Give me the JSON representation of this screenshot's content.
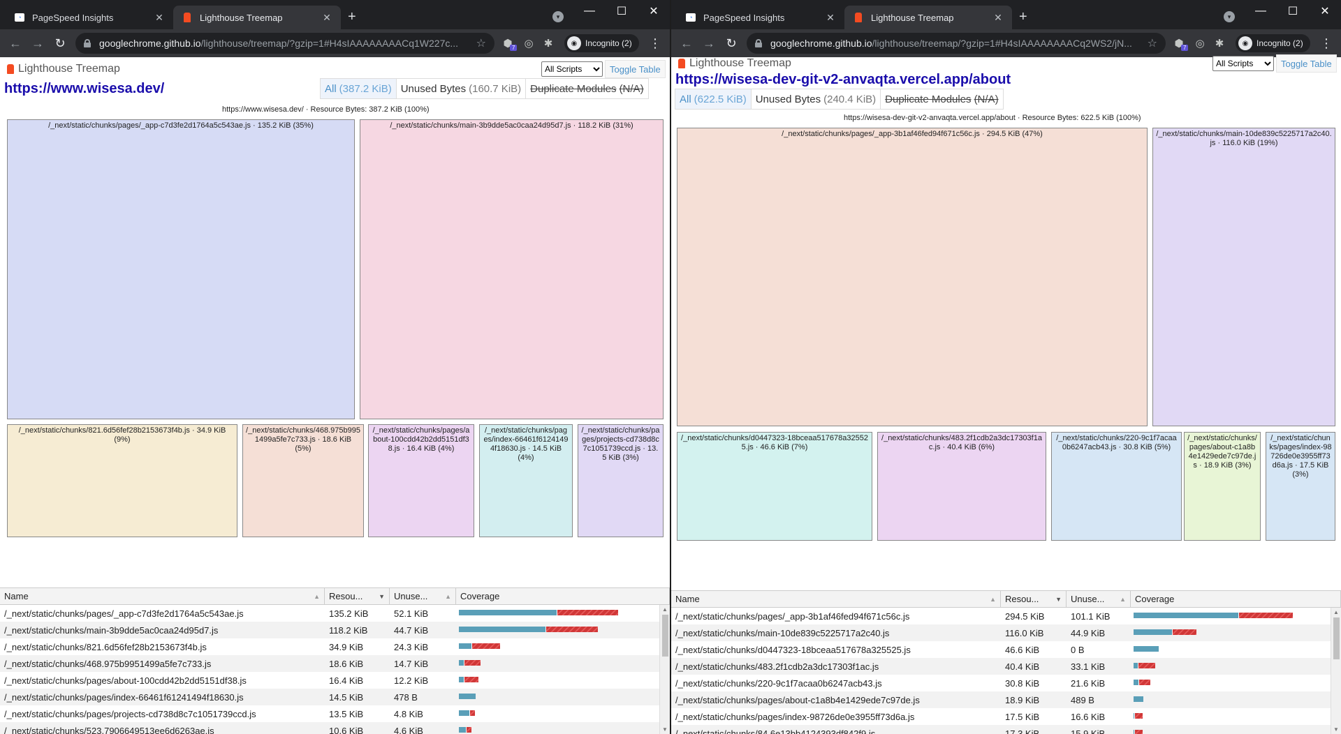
{
  "left": {
    "tabs": [
      {
        "title": "PageSpeed Insights"
      },
      {
        "title": "Lighthouse Treemap"
      }
    ],
    "address": {
      "host": "googlechrome.github.io",
      "path": "/lighthouse/treemap/?gzip=1#H4sIAAAAAAAACq1W227c..."
    },
    "incognito_label": "Incognito (2)",
    "extension_badge": "7",
    "brand": "Lighthouse Treemap",
    "site_url": "https://www.wisesa.dev/",
    "scripts_select": "All Scripts",
    "toggle_table": "Toggle Table",
    "modes": [
      {
        "label": "All",
        "amount": "(387.2 KiB)"
      },
      {
        "label": "Unused Bytes",
        "amount": "(160.7 KiB)"
      },
      {
        "label": "Duplicate Modules",
        "amount": "(N/A)"
      }
    ],
    "summary": "https://www.wisesa.dev/ · Resource Bytes: 387.2 KiB (100%)",
    "nodes": [
      {
        "label": "/_next/static/chunks/pages/_app-c7d3fe2d1764a5c543ae.js · 135.2 KiB (35%)",
        "color": "#d6dbf5"
      },
      {
        "label": "/_next/static/chunks/main-3b9dde5ac0caa24d95d7.js · 118.2 KiB (31%)",
        "color": "#f6d7e2"
      },
      {
        "label": "/_next/static/chunks/821.6d56fef28b2153673f4b.js · 34.9 KiB (9%)",
        "color": "#f6ecd3"
      },
      {
        "label": "/_next/static/chunks/468.975b9951499a5fe7c733.js · 18.6 KiB (5%)",
        "color": "#f5dfd6"
      },
      {
        "label": "/_next/static/chunks/pages/about-100cdd42b2dd5151df38.js · 16.4 KiB (4%)",
        "color": "#ecd5f2"
      },
      {
        "label": "/_next/static/chunks/pages/index-66461f61241494f18630.js · 14.5 KiB (4%)",
        "color": "#d3eef0"
      },
      {
        "label": "/_next/static/chunks/pages/projects-cd738d8c7c1051739ccd.js · 13.5 KiB (3%)",
        "color": "#e1d9f5"
      }
    ],
    "table": {
      "headers": {
        "name": "Name",
        "resource": "Resou...",
        "unused": "Unuse...",
        "coverage": "Coverage"
      },
      "rows": [
        {
          "name": "/_next/static/chunks/pages/_app-c7d3fe2d1764a5c543ae.js",
          "resource": "135.2 KiB",
          "unused": "52.1 KiB",
          "used_frac": 0.615,
          "total_frac": 1.0
        },
        {
          "name": "/_next/static/chunks/main-3b9dde5ac0caa24d95d7.js",
          "resource": "118.2 KiB",
          "unused": "44.7 KiB",
          "used_frac": 0.622,
          "total_frac": 0.874
        },
        {
          "name": "/_next/static/chunks/821.6d56fef28b2153673f4b.js",
          "resource": "34.9 KiB",
          "unused": "24.3 KiB",
          "used_frac": 0.304,
          "total_frac": 0.258
        },
        {
          "name": "/_next/static/chunks/468.975b9951499a5fe7c733.js",
          "resource": "18.6 KiB",
          "unused": "14.7 KiB",
          "used_frac": 0.21,
          "total_frac": 0.138
        },
        {
          "name": "/_next/static/chunks/pages/about-100cdd42b2dd5151df38.js",
          "resource": "16.4 KiB",
          "unused": "12.2 KiB",
          "used_frac": 0.256,
          "total_frac": 0.121
        },
        {
          "name": "/_next/static/chunks/pages/index-66461f61241494f18630.js",
          "resource": "14.5 KiB",
          "unused": "478 B",
          "used_frac": 0.968,
          "total_frac": 0.107
        },
        {
          "name": "/_next/static/chunks/pages/projects-cd738d8c7c1051739ccd.js",
          "resource": "13.5 KiB",
          "unused": "4.8 KiB",
          "used_frac": 0.644,
          "total_frac": 0.1
        },
        {
          "name": "/_next/static/chunks/523.7906649513ee6d6263ae.js",
          "resource": "10.6 KiB",
          "unused": "4.6 KiB",
          "used_frac": 0.566,
          "total_frac": 0.078
        }
      ]
    }
  },
  "right": {
    "tabs": [
      {
        "title": "PageSpeed Insights"
      },
      {
        "title": "Lighthouse Treemap"
      }
    ],
    "address": {
      "host": "googlechrome.github.io",
      "path": "/lighthouse/treemap/?gzip=1#H4sIAAAAAAAACq2WS2/jN..."
    },
    "incognito_label": "Incognito (2)",
    "extension_badge": "7",
    "brand": "Lighthouse Treemap",
    "site_url": "https://wisesa-dev-git-v2-anvaqta.vercel.app/about",
    "scripts_select": "All Scripts",
    "toggle_table": "Toggle Table",
    "modes": [
      {
        "label": "All",
        "amount": "(622.5 KiB)"
      },
      {
        "label": "Unused Bytes",
        "amount": "(240.4 KiB)"
      },
      {
        "label": "Duplicate Modules",
        "amount": "(N/A)"
      }
    ],
    "summary": "https://wisesa-dev-git-v2-anvaqta.vercel.app/about · Resource Bytes: 622.5 KiB (100%)",
    "nodes": [
      {
        "label": "/_next/static/chunks/pages/_app-3b1af46fed94f671c56c.js · 294.5 KiB (47%)",
        "color": "#f5dfd6"
      },
      {
        "label": "/_next/static/chunks/main-10de839c5225717a2c40.js · 116.0 KiB (19%)",
        "color": "#e1d9f5"
      },
      {
        "label": "/_next/static/chunks/d0447323-18bceaa517678a325525.js · 46.6 KiB (7%)",
        "color": "#d3f2ef"
      },
      {
        "label": "/_next/static/chunks/483.2f1cdb2a3dc17303f1ac.js · 40.4 KiB (6%)",
        "color": "#ecd5f2"
      },
      {
        "label": "/_next/static/chunks/220-9c1f7acaa0b6247acb43.js · 30.8 KiB (5%)",
        "color": "#d6e6f5"
      },
      {
        "label": "/_next/static/chunks/pages/about-c1a8b4e1429ede7c97de.js · 18.9 KiB (3%)",
        "color": "#e8f5d6"
      },
      {
        "label": "/_next/static/chunks/pages/index-98726de0e3955ff73d6a.js · 17.5 KiB (3%)",
        "color": "#d6e6f5"
      }
    ],
    "table": {
      "headers": {
        "name": "Name",
        "resource": "Resou...",
        "unused": "Unuse...",
        "coverage": "Coverage"
      },
      "rows": [
        {
          "name": "/_next/static/chunks/pages/_app-3b1af46fed94f671c56c.js",
          "resource": "294.5 KiB",
          "unused": "101.1 KiB",
          "used_frac": 0.657,
          "total_frac": 1.0
        },
        {
          "name": "/_next/static/chunks/main-10de839c5225717a2c40.js",
          "resource": "116.0 KiB",
          "unused": "44.9 KiB",
          "used_frac": 0.613,
          "total_frac": 0.394
        },
        {
          "name": "/_next/static/chunks/d0447323-18bceaa517678a325525.js",
          "resource": "46.6 KiB",
          "unused": "0 B",
          "used_frac": 1.0,
          "total_frac": 0.158
        },
        {
          "name": "/_next/static/chunks/483.2f1cdb2a3dc17303f1ac.js",
          "resource": "40.4 KiB",
          "unused": "33.1 KiB",
          "used_frac": 0.181,
          "total_frac": 0.137
        },
        {
          "name": "/_next/static/chunks/220-9c1f7acaa0b6247acb43.js",
          "resource": "30.8 KiB",
          "unused": "21.6 KiB",
          "used_frac": 0.299,
          "total_frac": 0.105
        },
        {
          "name": "/_next/static/chunks/pages/about-c1a8b4e1429ede7c97de.js",
          "resource": "18.9 KiB",
          "unused": "489 B",
          "used_frac": 0.975,
          "total_frac": 0.064
        },
        {
          "name": "/_next/static/chunks/pages/index-98726de0e3955ff73d6a.js",
          "resource": "17.5 KiB",
          "unused": "16.6 KiB",
          "used_frac": 0.051,
          "total_frac": 0.059
        },
        {
          "name": "/_next/static/chunks/84.6e13bb4124393df842f9.js",
          "resource": "17.3 KiB",
          "unused": "15.9 KiB",
          "used_frac": 0.081,
          "total_frac": 0.059
        }
      ]
    }
  }
}
